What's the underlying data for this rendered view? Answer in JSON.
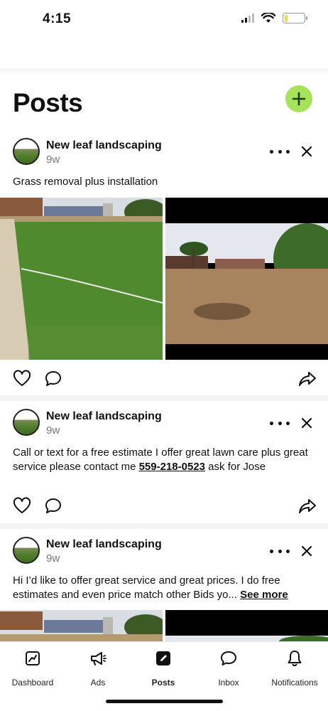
{
  "status_bar": {
    "time": "4:15"
  },
  "header": {
    "title": "Posts"
  },
  "posts": [
    {
      "author": "New leaf landscaping",
      "age": "9w",
      "text": "Grass removal plus installation"
    },
    {
      "author": "New leaf landscaping",
      "age": "9w",
      "text_before": "Call or text for a free estimate I offer great lawn care plus great service please contact me ",
      "phone": "559-218-0523",
      "text_after": " ask for Jose"
    },
    {
      "author": "New leaf landscaping",
      "age": "9w",
      "text": "Hi I’d like to offer great service and great prices. I do free estimates and even price match other Bids yo...",
      "see_more": "See more"
    }
  ],
  "bottom_nav": {
    "items": [
      {
        "label": "Dashboard",
        "icon": "chart-icon"
      },
      {
        "label": "Ads",
        "icon": "megaphone-icon"
      },
      {
        "label": "Posts",
        "icon": "edit-icon",
        "active": true
      },
      {
        "label": "Inbox",
        "icon": "chat-icon"
      },
      {
        "label": "Notifications",
        "icon": "bell-icon"
      }
    ]
  },
  "colors": {
    "accent": "#a7e35a",
    "text": "#111111",
    "muted": "#777777"
  }
}
